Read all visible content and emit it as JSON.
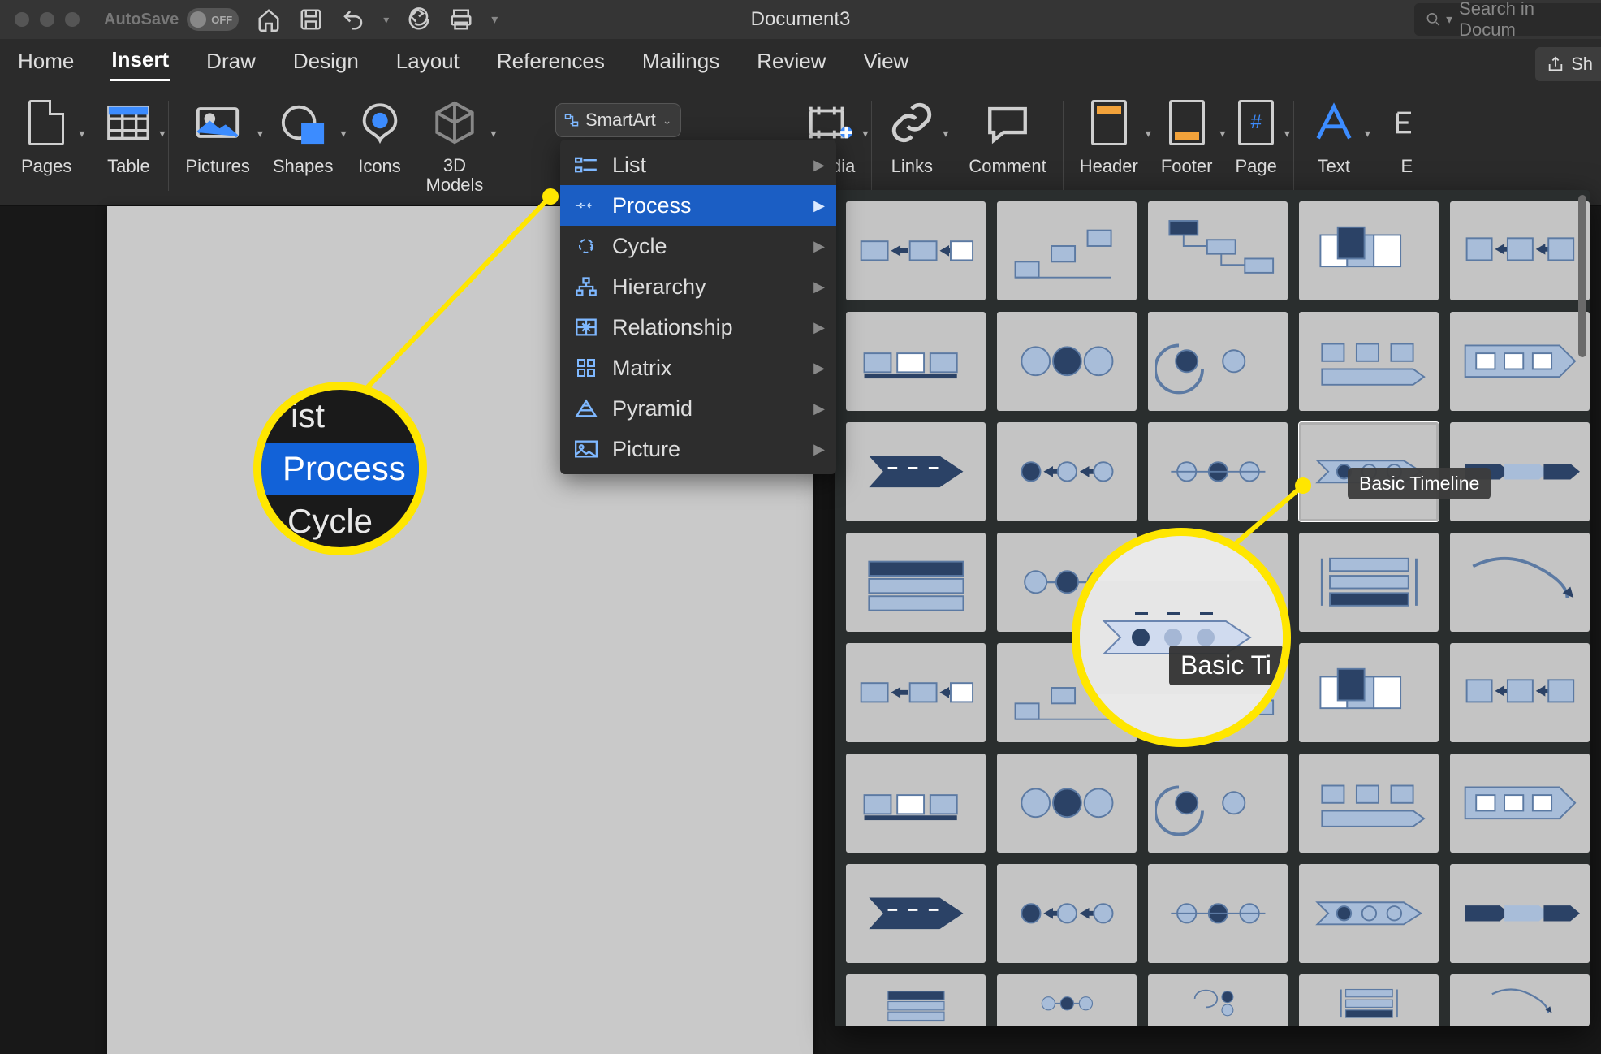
{
  "titlebar": {
    "autosave_label": "AutoSave",
    "autosave_state": "OFF",
    "document_title": "Document3",
    "search_placeholder": "Search in Docum"
  },
  "tabs": {
    "items": [
      "Home",
      "Insert",
      "Draw",
      "Design",
      "Layout",
      "References",
      "Mailings",
      "Review",
      "View"
    ],
    "active_index": 1,
    "share_label": "Sh"
  },
  "ribbon": {
    "groups": [
      {
        "label": "Pages",
        "icon": "pages-icon"
      },
      {
        "label": "Table",
        "icon": "table-icon"
      },
      {
        "label": "Pictures",
        "icon": "pictures-icon"
      },
      {
        "label": "Shapes",
        "icon": "shapes-icon"
      },
      {
        "label": "Icons",
        "icon": "icons-icon"
      },
      {
        "label": "3D Models",
        "icon": "models-icon"
      },
      {
        "label": "Media",
        "icon": "media-icon"
      },
      {
        "label": "Links",
        "icon": "links-icon"
      },
      {
        "label": "Comment",
        "icon": "comment-icon"
      },
      {
        "label": "Header",
        "icon": "header-icon"
      },
      {
        "label": "Footer",
        "icon": "footer-icon"
      },
      {
        "label": "Page",
        "icon": "page-number-icon"
      },
      {
        "label": "Text",
        "icon": "text-icon"
      },
      {
        "label": "E",
        "icon": "equation-icon"
      }
    ],
    "smartart_button": "SmartArt"
  },
  "smartart_menu": {
    "items": [
      {
        "label": "List",
        "icon": "list-icon"
      },
      {
        "label": "Process",
        "icon": "process-icon"
      },
      {
        "label": "Cycle",
        "icon": "cycle-icon"
      },
      {
        "label": "Hierarchy",
        "icon": "hierarchy-icon"
      },
      {
        "label": "Relationship",
        "icon": "relationship-icon"
      },
      {
        "label": "Matrix",
        "icon": "matrix-icon"
      },
      {
        "label": "Pyramid",
        "icon": "pyramid-icon"
      },
      {
        "label": "Picture",
        "icon": "picture-icon"
      }
    ],
    "selected_index": 1
  },
  "gallery": {
    "tooltip": "Basic Timeline",
    "selected_row": 2,
    "selected_col": 3,
    "rows": 8,
    "cols": 5
  },
  "zoom1": {
    "items": [
      "ist",
      "Process",
      "Cycle"
    ],
    "selected_index": 1
  },
  "zoom2": {
    "tooltip": "Basic Ti"
  },
  "colors": {
    "accent": "#1d8efc",
    "highlight": "#ffe600",
    "selected_blue": "#1262d8"
  }
}
